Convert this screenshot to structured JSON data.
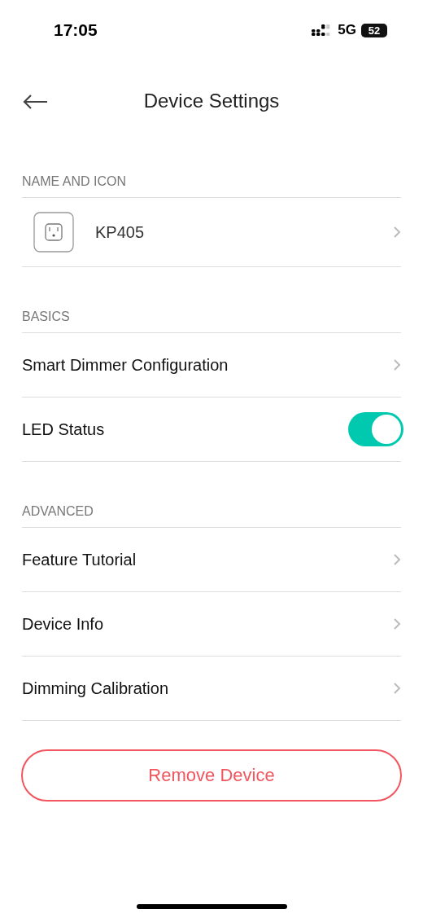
{
  "status_bar": {
    "time": "17:05",
    "network": "5G",
    "battery": "52"
  },
  "header": {
    "title": "Device Settings"
  },
  "sections": [
    {
      "title": "NAME AND ICON",
      "items": [
        {
          "kind": "device",
          "label": "KP405"
        }
      ]
    },
    {
      "title": "BASICS",
      "items": [
        {
          "kind": "link",
          "label": "Smart Dimmer Configuration"
        },
        {
          "kind": "toggle",
          "label": "LED Status",
          "on": true
        }
      ]
    },
    {
      "title": "ADVANCED",
      "items": [
        {
          "kind": "link",
          "label": "Feature Tutorial"
        },
        {
          "kind": "link",
          "label": "Device Info"
        },
        {
          "kind": "link",
          "label": "Dimming Calibration"
        }
      ]
    }
  ],
  "remove_button": {
    "label": "Remove Device"
  }
}
